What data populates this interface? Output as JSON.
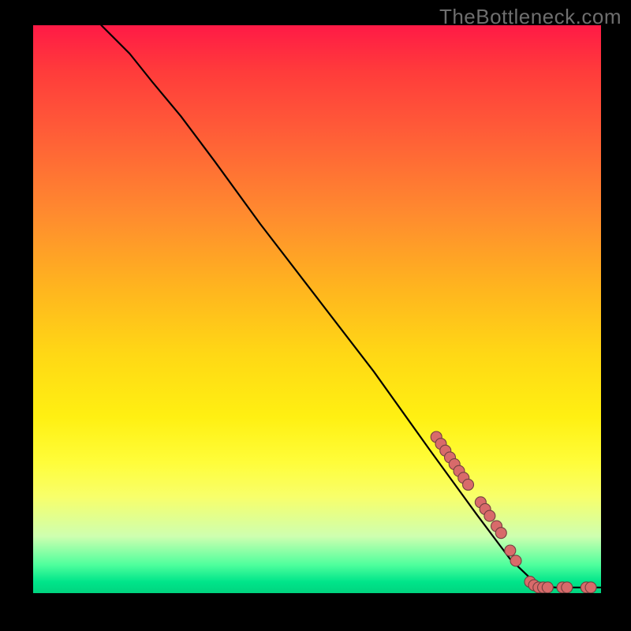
{
  "watermark": "TheBottleneck.com",
  "colors": {
    "point_fill": "#d86a6a",
    "point_stroke": "#734040",
    "curve": "#000000"
  },
  "chart_data": {
    "type": "line",
    "title": "",
    "xlabel": "",
    "ylabel": "",
    "xlim": [
      0,
      100
    ],
    "ylim": [
      0,
      100
    ],
    "grid": false,
    "legend": false,
    "series": [
      {
        "name": "curve",
        "x": [
          12,
          14,
          17,
          21,
          26,
          32,
          40,
          50,
          60,
          70,
          78,
          84,
          88,
          90,
          92,
          100
        ],
        "y": [
          100,
          98,
          95,
          90,
          84,
          76,
          65,
          52,
          39,
          25,
          14,
          6,
          2.2,
          1.2,
          1,
          1
        ]
      }
    ],
    "points": [
      {
        "x": 71.0,
        "y": 27.5
      },
      {
        "x": 71.8,
        "y": 26.3
      },
      {
        "x": 72.6,
        "y": 25.1
      },
      {
        "x": 73.4,
        "y": 23.9
      },
      {
        "x": 74.2,
        "y": 22.7
      },
      {
        "x": 75.0,
        "y": 21.5
      },
      {
        "x": 75.8,
        "y": 20.3
      },
      {
        "x": 76.6,
        "y": 19.1
      },
      {
        "x": 78.8,
        "y": 16.0
      },
      {
        "x": 79.6,
        "y": 14.8
      },
      {
        "x": 80.4,
        "y": 13.6
      },
      {
        "x": 81.6,
        "y": 11.8
      },
      {
        "x": 82.4,
        "y": 10.6
      },
      {
        "x": 84.0,
        "y": 7.5
      },
      {
        "x": 85.0,
        "y": 5.7
      },
      {
        "x": 87.5,
        "y": 2.0
      },
      {
        "x": 88.2,
        "y": 1.4
      },
      {
        "x": 89.0,
        "y": 1.0
      },
      {
        "x": 89.8,
        "y": 1.0
      },
      {
        "x": 90.6,
        "y": 1.0
      },
      {
        "x": 93.2,
        "y": 1.0
      },
      {
        "x": 94.0,
        "y": 1.0
      },
      {
        "x": 97.4,
        "y": 1.0
      },
      {
        "x": 98.2,
        "y": 1.0
      }
    ],
    "point_radius": 7
  }
}
